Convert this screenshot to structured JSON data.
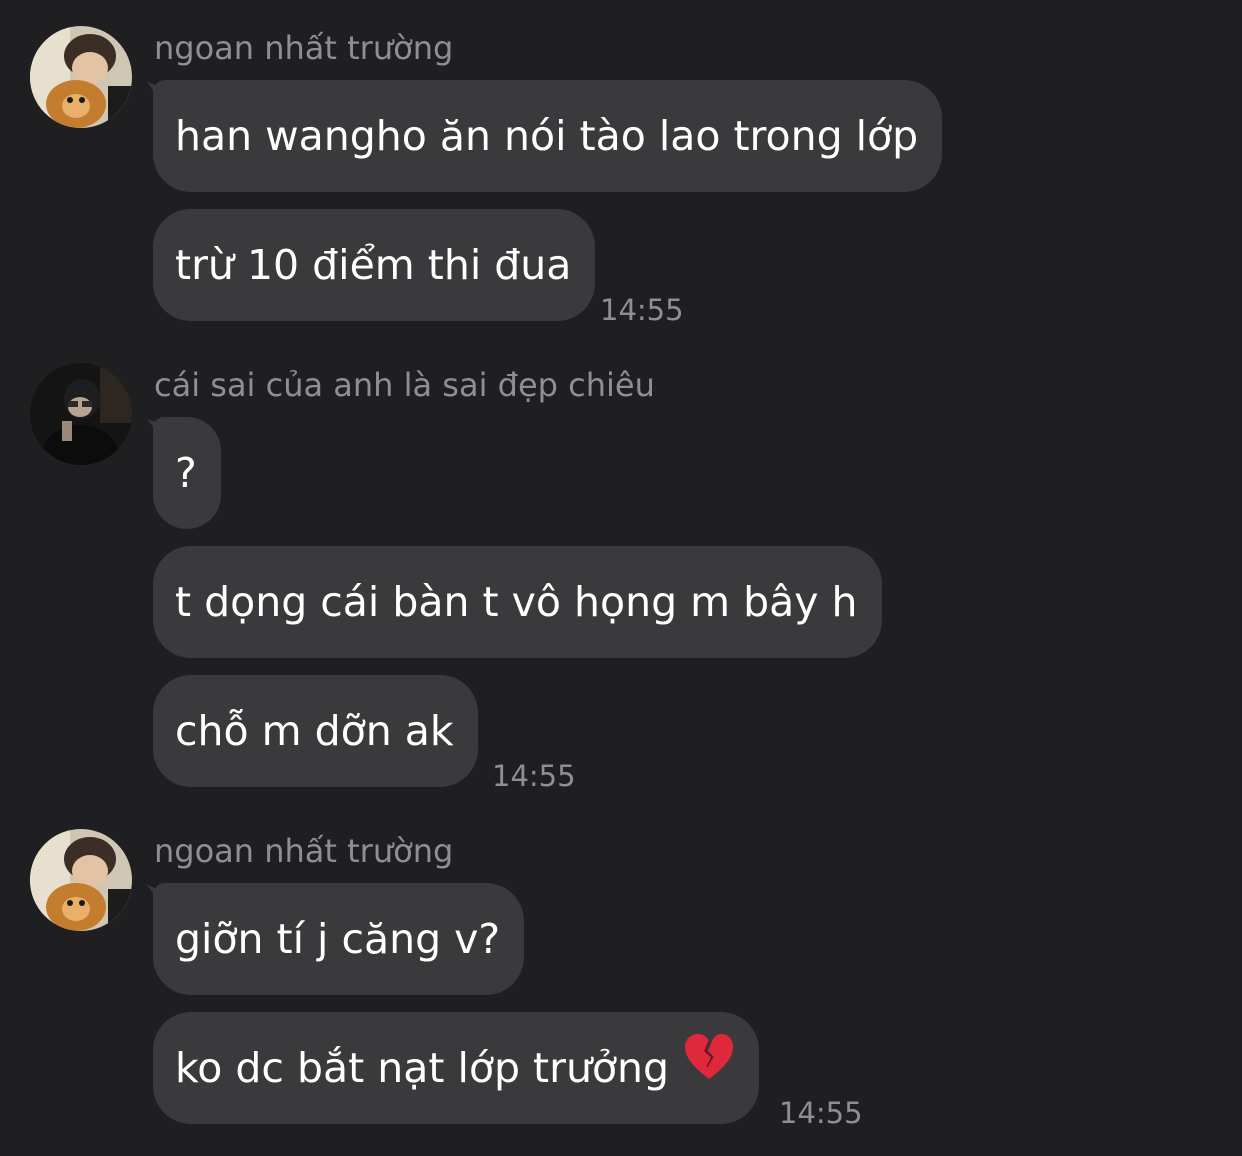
{
  "groups": [
    {
      "sender": "ngoan nhất trường",
      "avatar": "avatar-dog-icon",
      "messages": [
        "han wangho ăn nói tào lao trong lớp",
        "trừ 10 điểm thi đua"
      ],
      "time": "14:55"
    },
    {
      "sender": "cái sai của anh là sai đẹp chiêu",
      "avatar": "avatar-dark-icon",
      "messages": [
        "?",
        "t dọng cái bàn t vô họng m bây h",
        "chỗ m dỡn ak"
      ],
      "time": "14:55"
    },
    {
      "sender": "ngoan nhất trường",
      "avatar": "avatar-dog-icon",
      "messages": [
        "giỡn tí j căng v?",
        "ko dc bắt nạt lớp trưởng"
      ],
      "emoji": "broken-heart-icon",
      "time": "14:55"
    }
  ],
  "colors": {
    "background": "#1f1f21",
    "bubble": "#3a3a3c",
    "muted_text": "#8e8e93",
    "text": "#ffffff",
    "broken_heart": "#e0283d"
  }
}
